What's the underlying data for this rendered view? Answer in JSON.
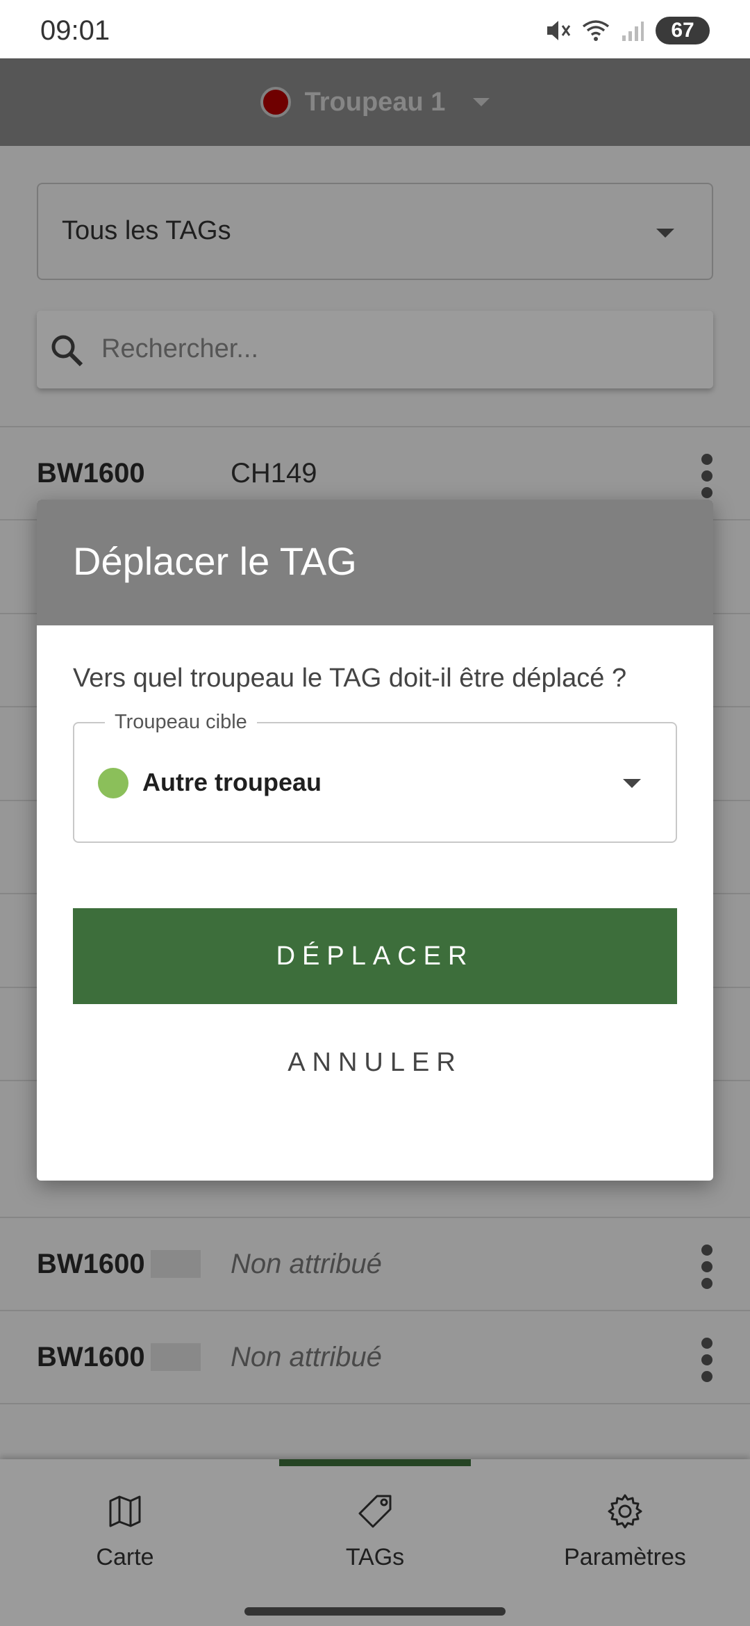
{
  "status_bar": {
    "time": "09:01",
    "battery": "67",
    "icons": [
      "mute-icon",
      "wifi-icon",
      "signal-icon",
      "battery-icon"
    ]
  },
  "header": {
    "herd_name": "Troupeau 1",
    "herd_color": "#b40000"
  },
  "filter": {
    "selected": "Tous les TAGs"
  },
  "search": {
    "placeholder": "Rechercher..."
  },
  "rows": [
    {
      "tag": "BW1600",
      "assigned": "CH149"
    },
    {
      "tag": "BW1600",
      "assigned": "Non attribué"
    },
    {
      "tag": "BW1600",
      "assigned": "Non attribué"
    }
  ],
  "dialog": {
    "title": "Déplacer le TAG",
    "question": "Vers quel troupeau le TAG doit-il être déplacé ?",
    "target_label": "Troupeau cible",
    "target_value": "Autre troupeau",
    "target_color": "#8bbf5a",
    "confirm_label": "DÉPLACER",
    "cancel_label": "ANNULER"
  },
  "bottom_nav": {
    "items": [
      {
        "label": "Carte",
        "icon": "map-icon"
      },
      {
        "label": "TAGs",
        "icon": "tag-icon"
      },
      {
        "label": "Paramètres",
        "icon": "gear-icon"
      }
    ],
    "active": "TAGs"
  },
  "colors": {
    "primary_green": "#3d6e3b",
    "header_gray": "#808080"
  }
}
